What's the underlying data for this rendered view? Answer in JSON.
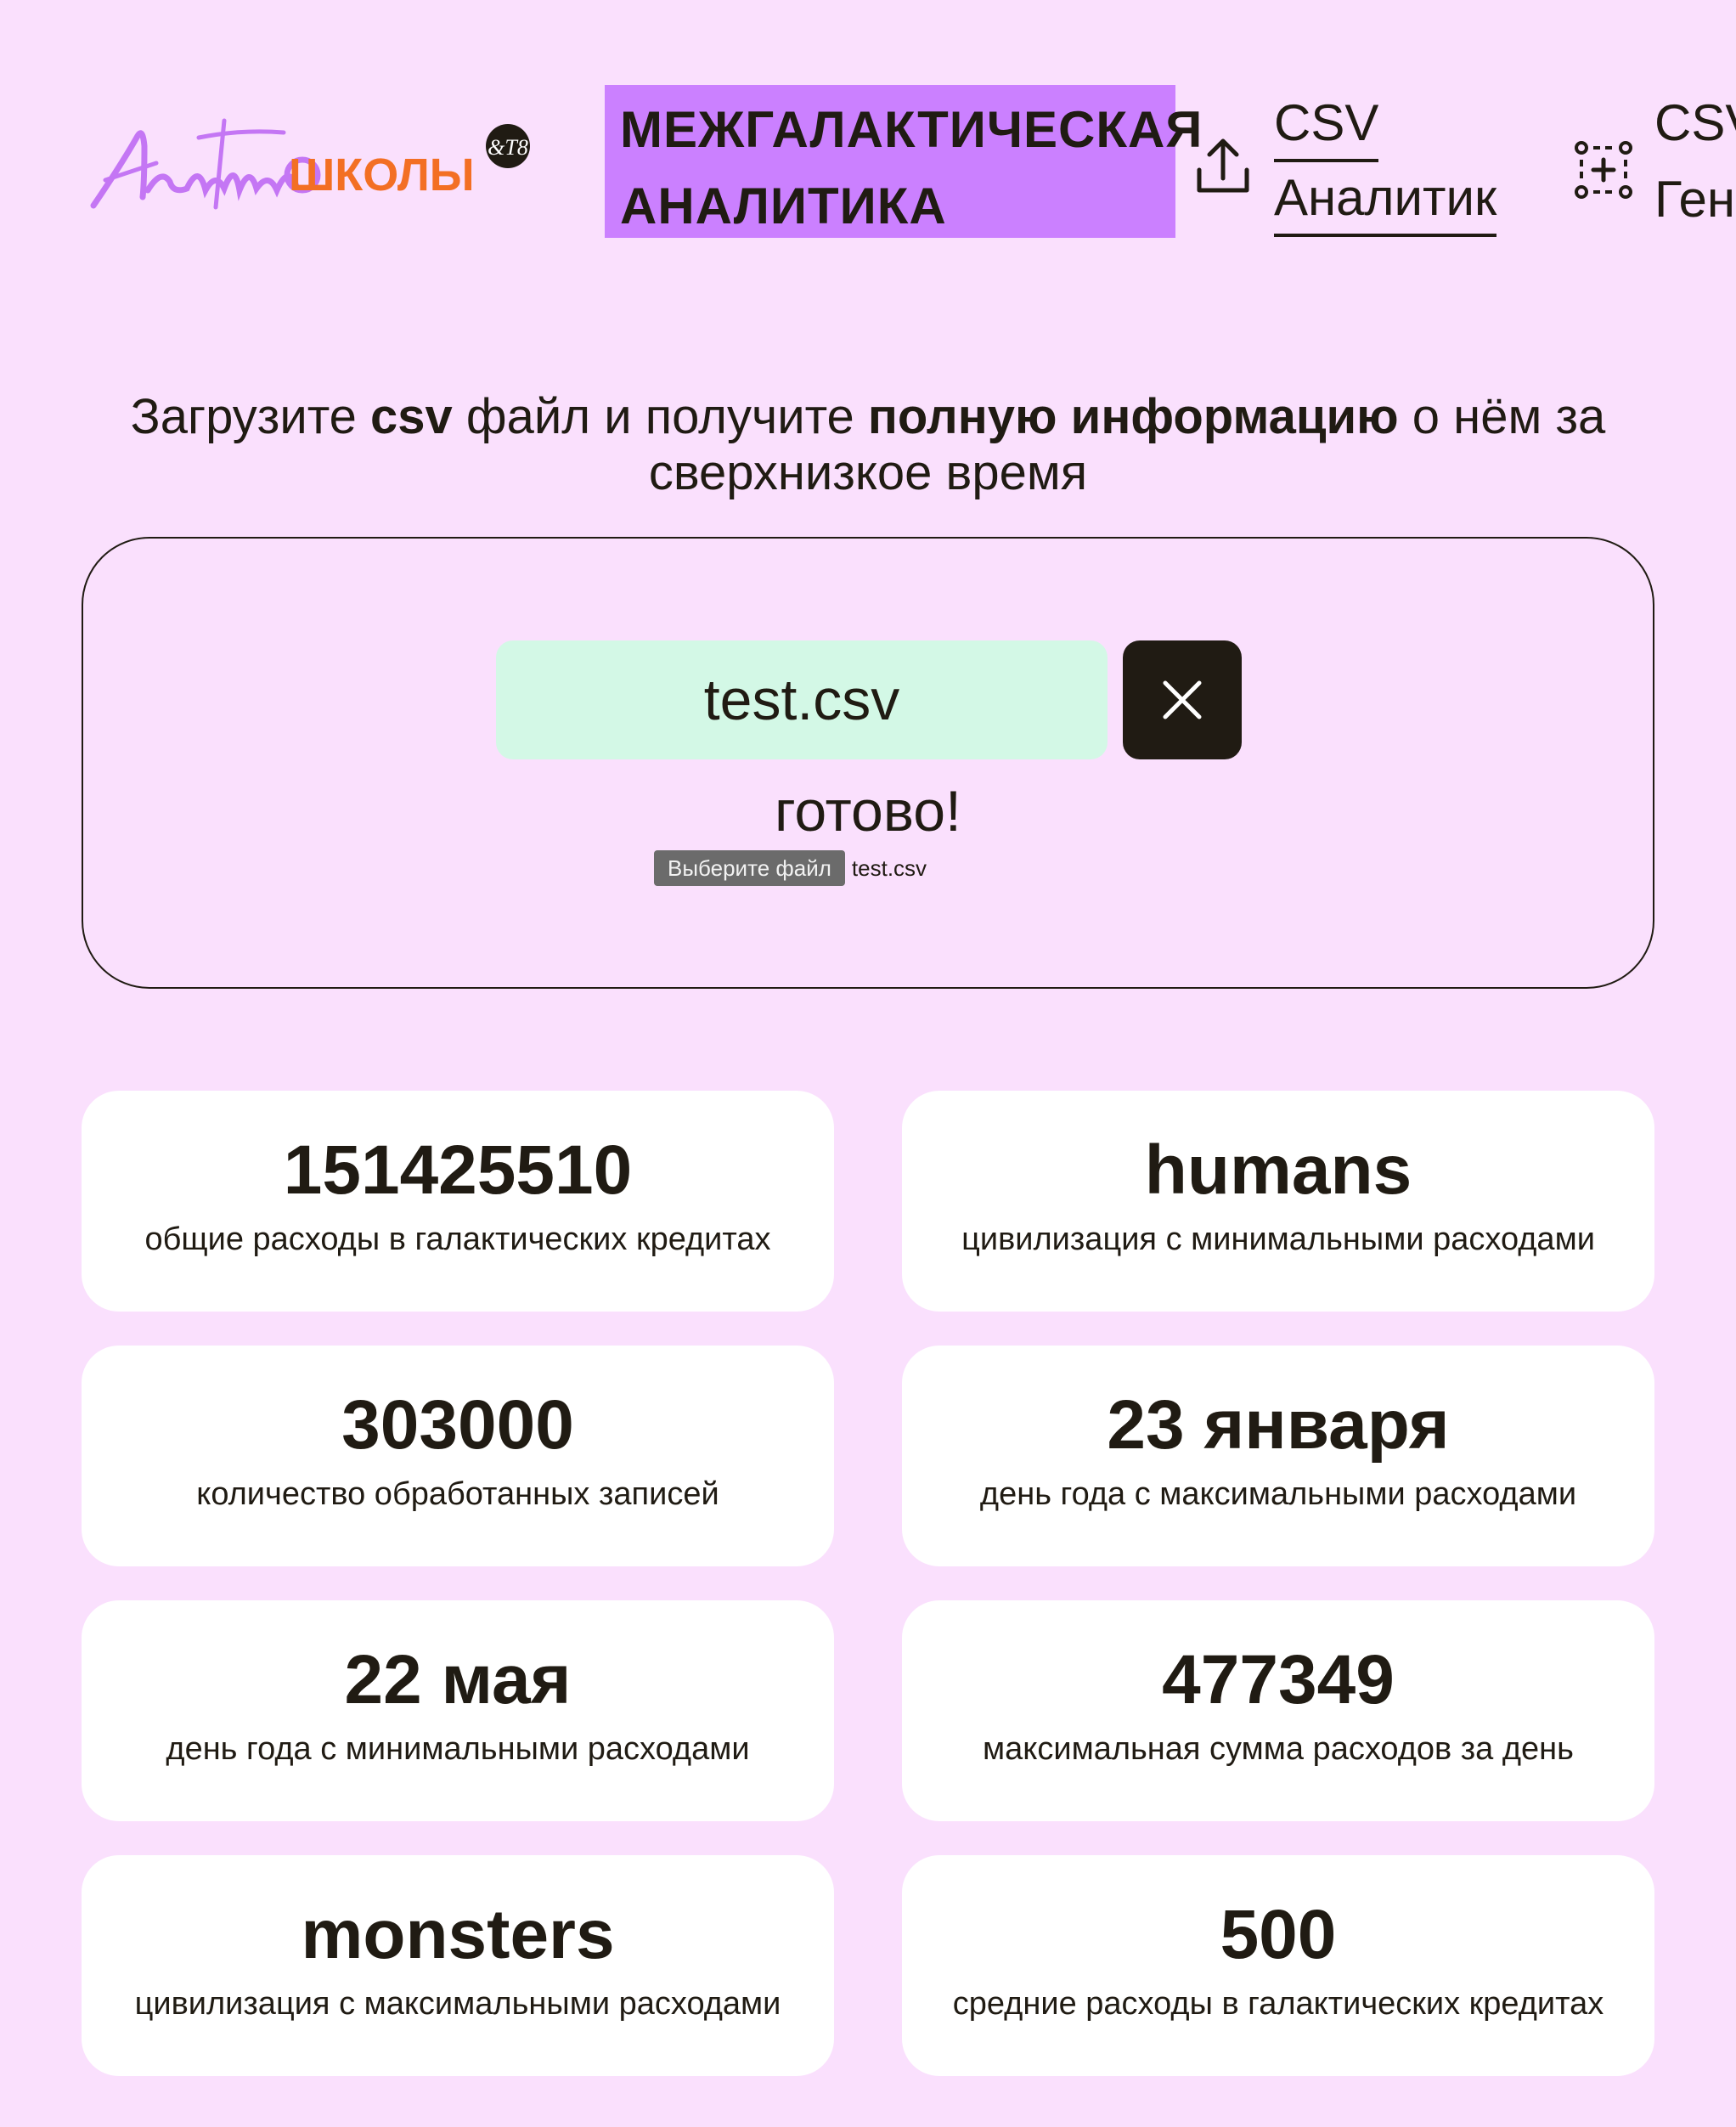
{
  "header": {
    "logo_text": "летние школы",
    "logo_badge": "&T8",
    "brand_line1": "МЕЖГАЛАКТИЧЕСКАЯ",
    "brand_line2": "АНАЛИТИКА",
    "nav": [
      {
        "line1": "CSV",
        "line2": "Аналитик",
        "icon": "upload-icon",
        "active": true
      },
      {
        "line1": "CSV",
        "line2": "Ген",
        "icon": "generate-icon",
        "active": false
      }
    ]
  },
  "intro": {
    "t1": "Загрузите ",
    "b1": "csv",
    "t2": " файл и получите ",
    "b2": "полную информацию",
    "t3": " о нём за",
    "line2": "сверхнизкое время"
  },
  "upload": {
    "file_name": "test.csv",
    "status": "готово!",
    "choose_label": "Выберите файл",
    "chosen_file": "test.csv"
  },
  "stats": [
    {
      "value": "151425510",
      "label": "общие расходы в галактических кредитах"
    },
    {
      "value": "humans",
      "label": "цивилизация с минимальными расходами"
    },
    {
      "value": "303000",
      "label": "количество обработанных записей"
    },
    {
      "value": "23 января",
      "label": "день года с максимальными расходами"
    },
    {
      "value": "22 мая",
      "label": "день года с минимальными расходами"
    },
    {
      "value": "477349",
      "label": "максимальная сумма расходов за день"
    },
    {
      "value": "monsters",
      "label": "цивилизация с максимальными расходами"
    },
    {
      "value": "500",
      "label": "средние расходы в галактических кредитах"
    }
  ],
  "colors": {
    "background": "#fae0fd",
    "brand": "#cb80ff",
    "file_pill": "#d3f8e6",
    "dark": "#201b13",
    "logo_purple": "#c476f4",
    "logo_orange": "#f36f24"
  }
}
